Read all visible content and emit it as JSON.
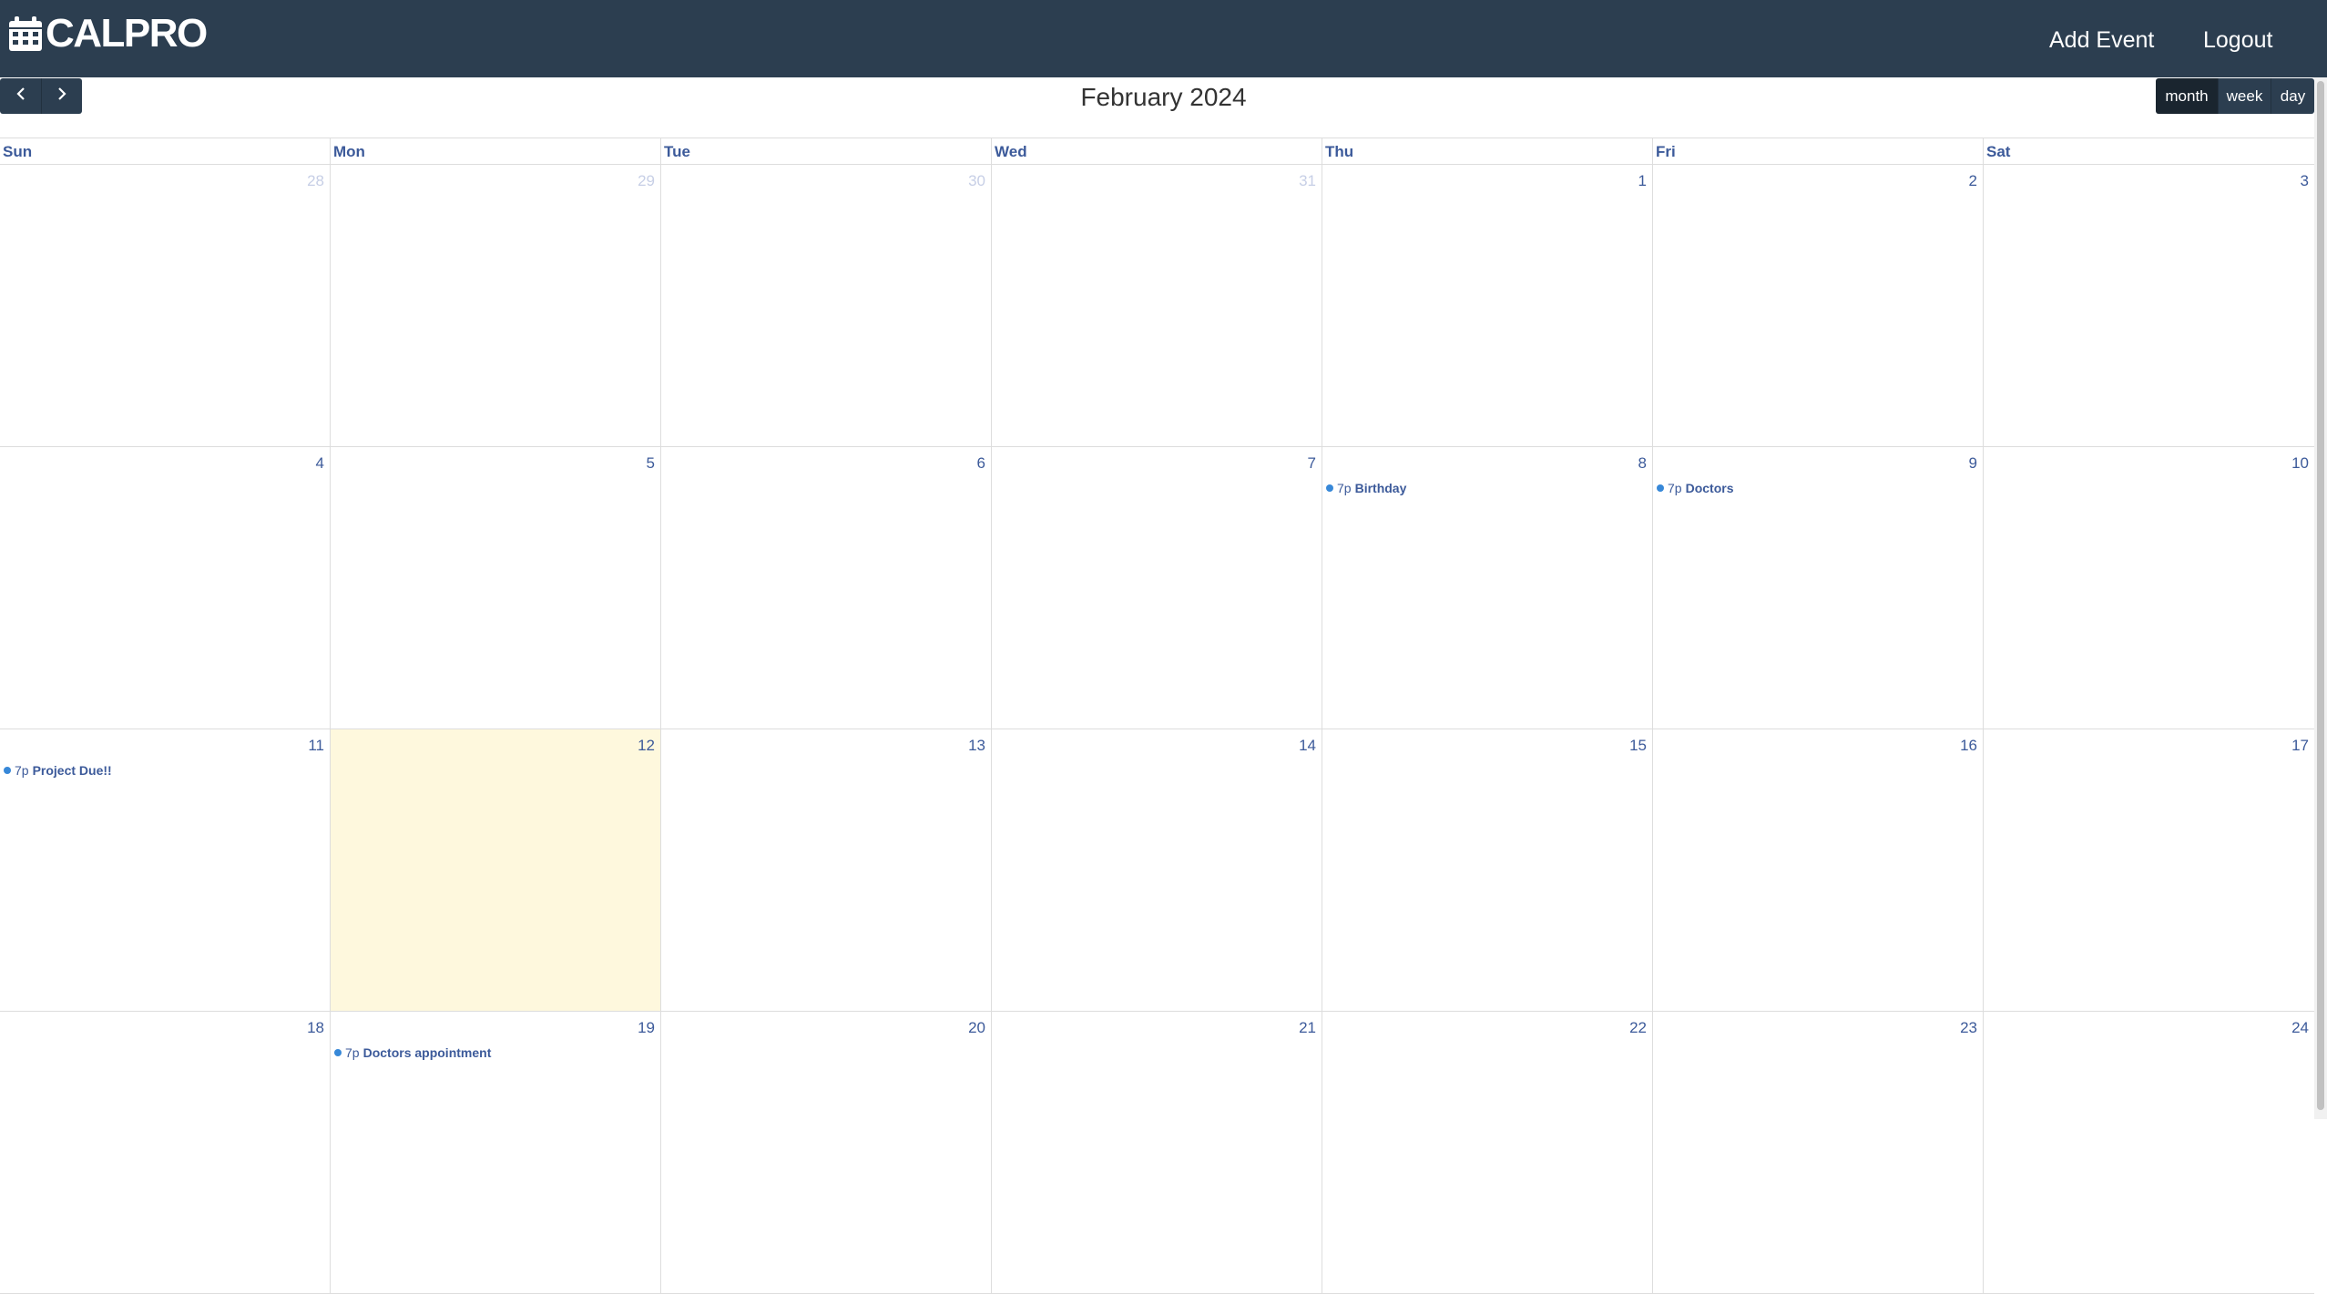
{
  "brand": {
    "name": "CALPRO",
    "icon": "calendar-icon"
  },
  "nav": {
    "add_event": "Add Event",
    "logout": "Logout"
  },
  "toolbar": {
    "title": "February 2024",
    "prev_icon": "chevron-left-icon",
    "next_icon": "chevron-right-icon",
    "views": {
      "month": "month",
      "week": "week",
      "day": "day"
    },
    "active_view": "month"
  },
  "weekdays": [
    "Sun",
    "Mon",
    "Tue",
    "Wed",
    "Thu",
    "Fri",
    "Sat"
  ],
  "weeks": [
    [
      {
        "date": "28",
        "other": true
      },
      {
        "date": "29",
        "other": true
      },
      {
        "date": "30",
        "other": true
      },
      {
        "date": "31",
        "other": true
      },
      {
        "date": "1"
      },
      {
        "date": "2"
      },
      {
        "date": "3"
      }
    ],
    [
      {
        "date": "4"
      },
      {
        "date": "5"
      },
      {
        "date": "6"
      },
      {
        "date": "7"
      },
      {
        "date": "8",
        "event": {
          "time": "7p",
          "title": "Birthday"
        }
      },
      {
        "date": "9",
        "event": {
          "time": "7p",
          "title": "Doctors"
        }
      },
      {
        "date": "10"
      }
    ],
    [
      {
        "date": "11",
        "event": {
          "time": "7p",
          "title": "Project Due!!"
        }
      },
      {
        "date": "12",
        "today": true
      },
      {
        "date": "13"
      },
      {
        "date": "14"
      },
      {
        "date": "15"
      },
      {
        "date": "16"
      },
      {
        "date": "17"
      }
    ],
    [
      {
        "date": "18"
      },
      {
        "date": "19",
        "event": {
          "time": "7p",
          "title": "Doctors appointment"
        }
      },
      {
        "date": "20"
      },
      {
        "date": "21"
      },
      {
        "date": "22"
      },
      {
        "date": "23"
      },
      {
        "date": "24"
      }
    ]
  ],
  "colors": {
    "navbar": "#2c3e50",
    "today_bg": "#fef8dd",
    "event_dot": "#3788d8",
    "link_text": "#3c5a9a"
  }
}
